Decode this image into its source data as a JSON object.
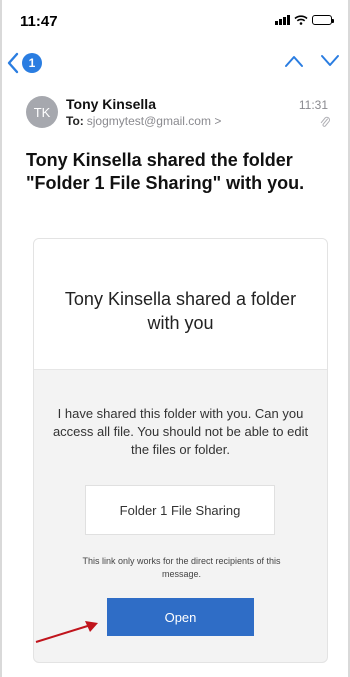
{
  "status_bar": {
    "time": "11:47"
  },
  "nav": {
    "unread_count": "1"
  },
  "message": {
    "avatar_initials": "TK",
    "sender": "Tony Kinsella",
    "to_label": "To:",
    "to_address": "sjogmytest@gmail.com >",
    "time": "11:31",
    "subject": "Tony Kinsella shared the folder \"Folder 1 File Sharing\" with you."
  },
  "card": {
    "title": "Tony Kinsella shared a folder with you",
    "body": "I have shared this folder with you.  Can you access all file.  You should not be able to edit the files or folder.",
    "folder_name": "Folder 1 File Sharing",
    "note": "This link only works for the direct recipients of this message.",
    "open_label": "Open"
  },
  "colors": {
    "accent": "#2a7de1",
    "button": "#2f6dc6",
    "annotation_arrow": "#c0141c"
  },
  "icons": [
    "back-chevron-icon",
    "chevron-up-icon",
    "chevron-down-icon",
    "signal-icon",
    "wifi-icon",
    "battery-icon",
    "paperclip-icon"
  ]
}
